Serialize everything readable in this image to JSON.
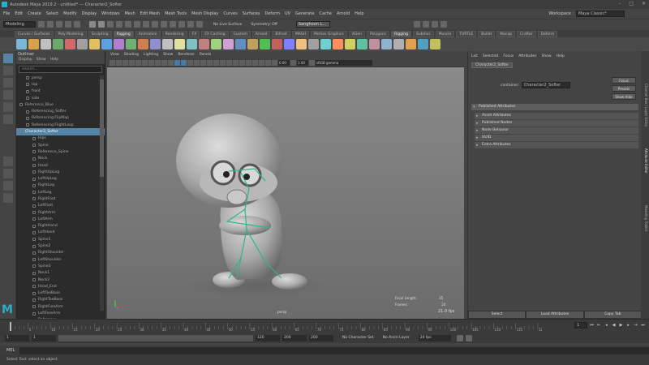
{
  "window": {
    "title": "Autodesk Maya 2019.2 - untitled*  ---  Character2_Softer",
    "controls": [
      "–",
      "□",
      "✕"
    ]
  },
  "menubar": {
    "items": [
      "File",
      "Edit",
      "Create",
      "Select",
      "Modify",
      "Display",
      "Windows",
      "Mesh",
      "Edit Mesh",
      "Mesh Tools",
      "Mesh Display",
      "Curves",
      "Surfaces",
      "Deform",
      "UV",
      "Generate",
      "Cache",
      "Arnold",
      "Help"
    ],
    "workspace_label": "Workspace :",
    "workspace_value": "Maya Classic*"
  },
  "statusline": {
    "mode": "Modeling",
    "symmetry": "Symmetry: Off",
    "live": "No Live Surface",
    "user": "Sanghoon L..."
  },
  "shelf": {
    "tabs": [
      "Curves / Surfaces",
      "Poly Modeling",
      "Sculpting",
      "Rigging",
      "Animation",
      "Rendering",
      "FX",
      "FX Caching",
      "Custom",
      "Arnold",
      "Bifrost",
      "MASH",
      "Motion Graphics",
      "XGen",
      "Polygons",
      "Rigging",
      "Subdivs",
      "Muscle",
      "TURTLE",
      "Bullet",
      "Mocap",
      "Crafter",
      "Deform"
    ],
    "active_tab": "Rigging",
    "tool_colors": [
      "#7bb8d8",
      "#d9a24a",
      "#c0c0c0",
      "#6aa96a",
      "#d06a6a",
      "#a0a0a0",
      "#e0c060",
      "#60a0e0",
      "#b080d0",
      "#70b070",
      "#d08050",
      "#9090d0",
      "#c0c0c0",
      "#e0e0a0",
      "#80c0c0",
      "#c08080",
      "#a0d080",
      "#d0a0d0",
      "#6090c0",
      "#c0a060",
      "#50c050",
      "#c06060",
      "#8080ff",
      "#f0c080",
      "#a0a0a0",
      "#70d0d0",
      "#ff9060",
      "#d0d060",
      "#60c0a0",
      "#c090a0",
      "#90b0d0",
      "#b0b0b0",
      "#e0a050",
      "#50a0c0",
      "#c0c060"
    ]
  },
  "outliner": {
    "title": "Outliner",
    "menus": [
      "Display",
      "Show",
      "Help"
    ],
    "search_placeholder": "search...",
    "items": [
      {
        "label": "persp",
        "indent": 1,
        "sel": false
      },
      {
        "label": "top",
        "indent": 1,
        "sel": false
      },
      {
        "label": "front",
        "indent": 1,
        "sel": false
      },
      {
        "label": "side",
        "indent": 1,
        "sel": false
      },
      {
        "label": "Reference_Blue",
        "indent": 0,
        "sel": false
      },
      {
        "label": "Referencing_Softer",
        "indent": 1,
        "sel": false
      },
      {
        "label": "Referencing:FlipMap",
        "indent": 1,
        "sel": false
      },
      {
        "label": "Referencing:FlightLoop",
        "indent": 1,
        "sel": false
      },
      {
        "label": "Character2_Softer",
        "indent": 0,
        "sel": true
      },
      {
        "label": "Hips",
        "indent": 2,
        "sel": false
      },
      {
        "label": "Spine",
        "indent": 2,
        "sel": false
      },
      {
        "label": "Reference_Spine",
        "indent": 2,
        "sel": false
      },
      {
        "label": "Neck",
        "indent": 2,
        "sel": false
      },
      {
        "label": "Head",
        "indent": 2,
        "sel": false
      },
      {
        "label": "RightUpLeg",
        "indent": 2,
        "sel": false
      },
      {
        "label": "LeftUpLeg",
        "indent": 2,
        "sel": false
      },
      {
        "label": "RightLeg",
        "indent": 2,
        "sel": false
      },
      {
        "label": "LeftLeg",
        "indent": 2,
        "sel": false
      },
      {
        "label": "RightFoot",
        "indent": 2,
        "sel": false
      },
      {
        "label": "LeftFoot",
        "indent": 2,
        "sel": false
      },
      {
        "label": "RightArm",
        "indent": 2,
        "sel": false
      },
      {
        "label": "LeftArm",
        "indent": 2,
        "sel": false
      },
      {
        "label": "RightHand",
        "indent": 2,
        "sel": false
      },
      {
        "label": "LeftHand",
        "indent": 2,
        "sel": false
      },
      {
        "label": "Spine1",
        "indent": 2,
        "sel": false
      },
      {
        "label": "Spine2",
        "indent": 2,
        "sel": false
      },
      {
        "label": "RightShoulder",
        "indent": 2,
        "sel": false
      },
      {
        "label": "LeftShoulder",
        "indent": 2,
        "sel": false
      },
      {
        "label": "Spine3",
        "indent": 2,
        "sel": false
      },
      {
        "label": "Neck1",
        "indent": 2,
        "sel": false
      },
      {
        "label": "Neck2",
        "indent": 2,
        "sel": false
      },
      {
        "label": "Head_End",
        "indent": 2,
        "sel": false
      },
      {
        "label": "LeftToeBase",
        "indent": 2,
        "sel": false
      },
      {
        "label": "RightToeBase",
        "indent": 2,
        "sel": false
      },
      {
        "label": "RightForeArm",
        "indent": 2,
        "sel": false
      },
      {
        "label": "LeftForeArm",
        "indent": 2,
        "sel": false
      },
      {
        "label": "Reference",
        "indent": 2,
        "sel": false
      },
      {
        "label": "SkeletonRoot",
        "indent": 2,
        "sel": false
      }
    ]
  },
  "viewport": {
    "menus": [
      "View",
      "Shading",
      "Lighting",
      "Show",
      "Renderer",
      "Panels"
    ],
    "cam_near": "0.00",
    "cam_far": "1.00",
    "colorspace": "sRGB gamma",
    "camera_label": "persp",
    "fps": "21.0 fps",
    "hud": [
      {
        "label": "Focal Length:",
        "value": "35"
      },
      {
        "label": "Frames:",
        "value": "24"
      }
    ]
  },
  "attribute_editor": {
    "menus": [
      "List",
      "Selected",
      "Focus",
      "Attributes",
      "Show",
      "Help"
    ],
    "node_tab": "Character2_Softer",
    "node_label": "container:",
    "node_value": "Character2_Softer",
    "buttons": [
      "Focus",
      "Presets",
      "Show  Hide"
    ],
    "sections": [
      {
        "label": "Published Attributes",
        "open": true
      },
      {
        "label": "Asset Attributes",
        "open": false
      },
      {
        "label": "Published Nodes",
        "open": false
      },
      {
        "label": "Node Behavior",
        "open": false
      },
      {
        "label": "UUID",
        "open": false
      },
      {
        "label": "Extra Attributes",
        "open": false
      }
    ],
    "bottom_buttons": [
      "Select",
      "Load Attributes",
      "Copy Tab"
    ]
  },
  "sidetabs": [
    "Attribute Editor",
    "Channel Box / Layer Editor",
    "Modeling Toolkit"
  ],
  "timeslider": {
    "ticks": [
      "5",
      "10",
      "15",
      "20",
      "25",
      "30",
      "35",
      "40",
      "45",
      "50",
      "55",
      "60",
      "65",
      "70",
      "75",
      "80",
      "85",
      "90",
      "95",
      "100",
      "105",
      "110",
      "115",
      "120"
    ],
    "current_frame": "1"
  },
  "rangeslider": {
    "start": "1",
    "range_start": "1",
    "range_end": "120",
    "end": "200",
    "end_field": "200",
    "character_set": "No Character Set",
    "anim_layer": "No Anim Layer",
    "fps": "24 fps"
  },
  "cmdline": {
    "lang": "MEL",
    "help": "Select Tool: select an object"
  }
}
